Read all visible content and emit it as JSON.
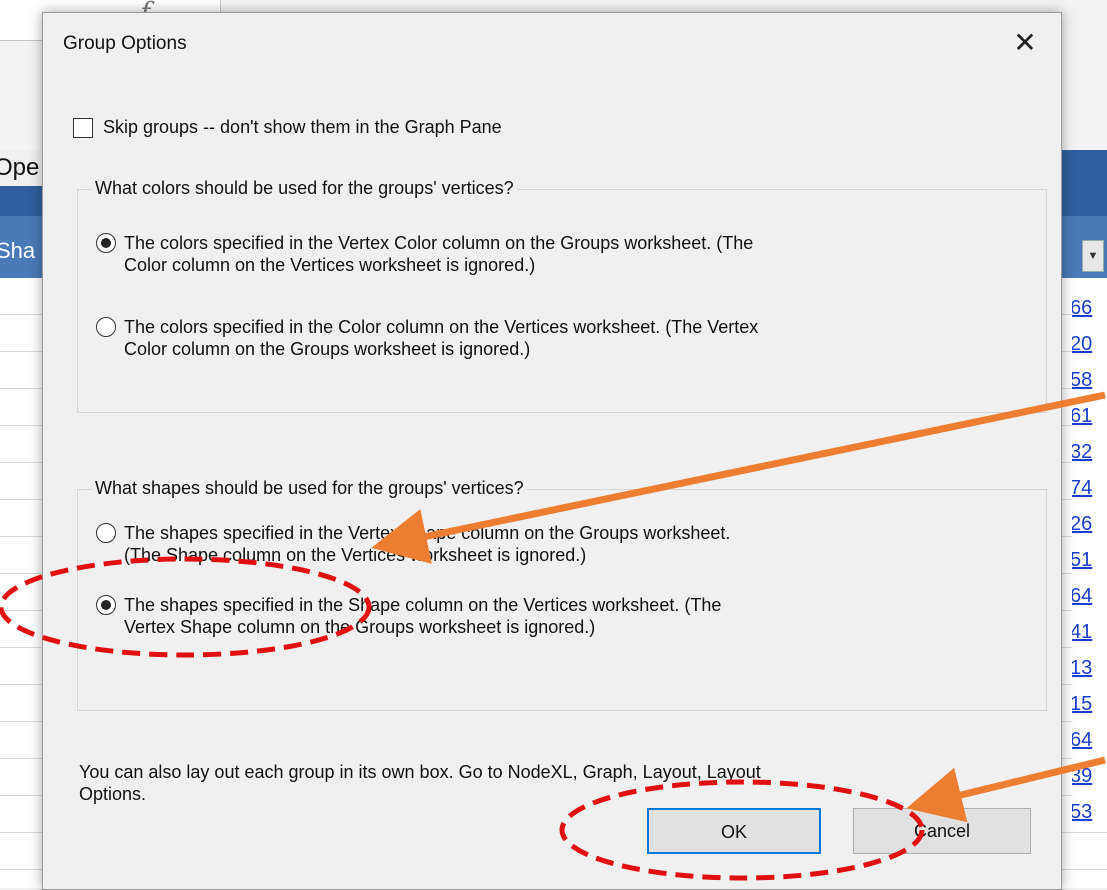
{
  "background": {
    "formula_glyph": "f",
    "header_fragment": "Ope",
    "column_fragment": "Sha",
    "dropdown_glyph": "▼",
    "link_fragments": [
      "66",
      "20",
      "58",
      "61",
      "32",
      "74",
      "26",
      "51",
      "64",
      "41",
      "13",
      "15",
      "64",
      "39",
      "53"
    ]
  },
  "dialog": {
    "title": "Group Options",
    "close_glyph": "✕",
    "skip_groups": {
      "label": "Skip groups -- don't show them in the Graph Pane",
      "checked": false
    },
    "colors_group": {
      "legend": "What colors should be used for the groups' vertices?",
      "options": [
        {
          "text": "The colors specified in the Vertex Color column on the Groups worksheet.  (The\nColor column on the Vertices worksheet is ignored.)",
          "checked": true
        },
        {
          "text": "The colors specified in the Color column on the Vertices worksheet.  (The Vertex\nColor column on the Groups worksheet is ignored.)",
          "checked": false
        }
      ]
    },
    "shapes_group": {
      "legend": "What shapes should be used for the groups' vertices?",
      "options": [
        {
          "text": "The shapes specified in the Vertex Shape column on the Groups worksheet.\n(The Shape column on the Vertices worksheet is ignored.)",
          "checked": false
        },
        {
          "text": "The shapes specified in the Shape column on the Vertices worksheet.  (The\nVertex Shape column on the Groups worksheet is ignored.)",
          "checked": true
        }
      ]
    },
    "note": "You can also lay out each group in its own box.  Go to NodeXL, Graph, Layout, Layout\nOptions.",
    "ok_label": "OK",
    "cancel_label": "Cancel"
  },
  "annotations": {
    "arrow_color": "#ed7d31",
    "ellipse_color": "#e01010"
  }
}
